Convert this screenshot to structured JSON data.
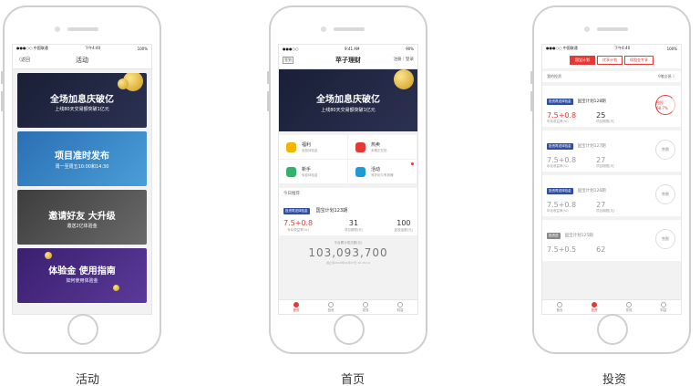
{
  "captions": [
    "活动",
    "首页",
    "投资"
  ],
  "activity": {
    "status_left": "●●●○○ 中国联通 ",
    "status_time": "下午4:40",
    "status_right": "100%",
    "nav_back": "〈返回",
    "nav_title": "活动",
    "banners": [
      {
        "title": "全场加息庆破亿",
        "sub": "上线80天交易额突破1亿元"
      },
      {
        "title": "项目准时发布",
        "sub": "周一至周五10:00和14:30"
      },
      {
        "title": "邀请好友 大升级",
        "sub": "邀送2亿体验金"
      },
      {
        "title": "体验金 使用指南",
        "sub": "如何使用体验金"
      }
    ]
  },
  "home": {
    "status_left": "●●●○○ ",
    "status_time": "9:41 AM",
    "status_right": "90%",
    "nav_left": "签到",
    "nav_title": "苹子理财",
    "nav_right": "注册｜登录",
    "hero_title": "全场加息庆破亿",
    "hero_sub": "上线80天交易额突破1亿元",
    "grid": [
      {
        "title": "福利",
        "sub": "免费体验金",
        "color": "#f4b400"
      },
      {
        "title": "热卖",
        "sub": "本期正在抢",
        "color": "#e53935"
      },
      {
        "title": "新手",
        "sub": "免费体验金",
        "color": "#2fb36b"
      },
      {
        "title": "活动",
        "sub": "有好玩又有钱赚",
        "color": "#1e9bd7"
      }
    ],
    "rec_label": "今日推荐",
    "rec_tag": "投资再送体验金",
    "rec_name": "国宝计划123期",
    "rec_rate": "7.5+0.8",
    "rec_days": "31",
    "rec_min": "100",
    "rec_rate_label": "年化收益率(%)",
    "rec_days_label": "项目期限(天)",
    "rec_min_label": "起投金额(元)",
    "total_label": "平台累计成交额(元)",
    "total": "103,093,700",
    "total_note": "截止到2016年04月27日  10:15:14",
    "tabs": [
      "首页",
      "投资",
      "发现",
      "财富"
    ]
  },
  "invest": {
    "status_left": "●●●○○ 中国联通 ",
    "status_time": "下午4:40",
    "status_right": "100%",
    "segments": [
      "国宝计划",
      "优享计划",
      "续租金专享"
    ],
    "my_invest": "我的投资",
    "my_invest_right": "9笔交易 〉",
    "cards": [
      {
        "tag": "投资再送体验金",
        "name": "国宝计划128期",
        "rate": "7.5+0.8",
        "days": "25",
        "ring": "抢投 68.7%",
        "hot": true
      },
      {
        "tag": "投资再送体验金",
        "name": "国宝计划127期",
        "rate": "7.5+0.8",
        "days": "27",
        "ring": "售罄",
        "hot": false
      },
      {
        "tag": "投资再送体验金",
        "name": "国宝计划126期",
        "rate": "7.5+0.8",
        "days": "27",
        "ring": "售罄",
        "hot": false
      },
      {
        "tag": "投资送",
        "name": "国宝计划125期",
        "rate": "7.5+0.5",
        "days": "62",
        "ring": "售罄",
        "hot": false
      }
    ],
    "rate_label": "年化收益率(%)",
    "days_label": "项目期限(天)",
    "tabs": [
      "首页",
      "投资",
      "发现",
      "财富"
    ]
  }
}
